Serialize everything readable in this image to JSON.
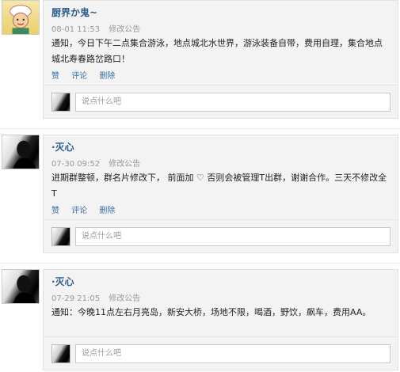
{
  "posts": [
    {
      "author": "厨界か鬼~",
      "time": "08-01 11:53",
      "edit": "修改公告",
      "content": "通知，今日下午二点集合游泳，地点城北水世界，游泳装备自带，费用自理，集合地点城北寿春路岔路口！",
      "actions": {
        "like": "赞",
        "comment": "评论",
        "delete": "删除"
      },
      "placeholder": "说点什么吧"
    },
    {
      "author": "·灭心",
      "time": "07-30 09:52",
      "edit": "修改公告",
      "content": "进期群整顿，群名片修改下，  前面加 ♡ 否则会被管理T出群，谢谢合作。三天不修改全T",
      "actions": {
        "like": "赞",
        "comment": "评论",
        "delete": "删除"
      },
      "placeholder": "说点什么吧"
    },
    {
      "author": "·灭心",
      "time": "07-29 21:05",
      "edit": "修改公告",
      "content": "通知：今晚11点左右月亮岛，新安大桥，场地不限，喝酒，野饮，飙车，费用AA。",
      "actions": {},
      "placeholder": "说点什么吧"
    }
  ]
}
